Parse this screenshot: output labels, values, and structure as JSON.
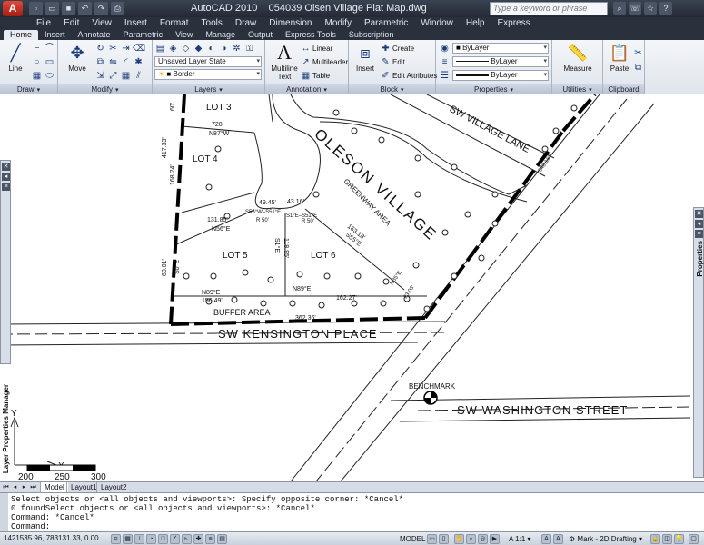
{
  "title_bar": {
    "app_name": "AutoCAD 2010",
    "file_name": "054039 Olsen Village Plat Map.dwg",
    "logo_letter": "A",
    "search_placeholder": "Type a keyword or phrase",
    "qat_icons": [
      "new-icon",
      "open-icon",
      "save-icon",
      "undo-icon",
      "redo-icon",
      "plot-icon"
    ],
    "info_icons": [
      "binoculars-icon",
      "communication-center-icon",
      "favorites-icon",
      "help-icon"
    ]
  },
  "menu": [
    "File",
    "Edit",
    "View",
    "Insert",
    "Format",
    "Tools",
    "Draw",
    "Dimension",
    "Modify",
    "Parametric",
    "Window",
    "Help",
    "Express"
  ],
  "ribbon_tabs": [
    "Home",
    "Insert",
    "Annotate",
    "Parametric",
    "View",
    "Manage",
    "Output",
    "Express Tools",
    "Subscription"
  ],
  "active_ribbon_tab": "Home",
  "ribbon": {
    "draw": {
      "title": "Draw",
      "line_label": "Line"
    },
    "modify": {
      "title": "Modify",
      "move_label": "Move"
    },
    "layers": {
      "title": "Layers",
      "layer_state": "Unsaved Layer State",
      "current_layer": "Border"
    },
    "annotation": {
      "title": "Annotation",
      "multiline_text_label": "Multiline Text",
      "linear_label": "Linear",
      "multileader_label": "Multileader",
      "table_label": "Table"
    },
    "block": {
      "title": "Block",
      "insert_label": "Insert",
      "create_label": "Create",
      "edit_label": "Edit",
      "edit_attributes_label": "Edit Attributes"
    },
    "properties": {
      "title": "Properties",
      "color_value": "ByLayer",
      "linetype_value": "ByLayer",
      "lineweight_value": "ByLayer"
    },
    "utilities": {
      "title": "Utilities",
      "measure_label": "Measure"
    },
    "clipboard": {
      "title": "Clipboard",
      "paste_label": "Paste"
    }
  },
  "drawing": {
    "lots": [
      "LOT 3",
      "LOT 4",
      "LOT 5",
      "LOT 6"
    ],
    "street_labels": [
      "SW KENSINGTON PLACE",
      "SW WASHINGTON STREET",
      "SW VILLAGE LANE",
      "OLESON VILLAGE",
      "GREENWAY AREA",
      "BUFFER AREA",
      "BENCHMARK"
    ],
    "dimensions": [
      "720'",
      "N87°W",
      "417.33'",
      "168.24'",
      "131.85'",
      "N56°E",
      "49.45'",
      "43.16'",
      "S55°W–S51°E",
      "R 50'",
      "S1°E–S51°E",
      "R 50'",
      "118.95'",
      "S1°E",
      "163.18'",
      "S55°E",
      "N89°E",
      "162.27'",
      "N89°E",
      "156.49'",
      "N35°E",
      "23.06'",
      "60.01'",
      "S0°E",
      "362.36'",
      "S48.16'",
      "60'"
    ],
    "scale_bar": [
      "200",
      "250",
      "300"
    ],
    "ucs_y": "Y",
    "ucs_x": "X"
  },
  "palettes": {
    "left_label": "Layer Properties Manager",
    "right_label": "Properties"
  },
  "layout_tabs": [
    "Model",
    "Layout1",
    "Layout2"
  ],
  "active_layout": "Model",
  "command_lines": [
    "Select objects or <all objects and viewports>: Specify opposite corner: *Cancel*",
    "0 foundSelect objects or <all objects and viewports>: *Cancel*",
    "Command: *Cancel*",
    "Command:"
  ],
  "status": {
    "coords": "1421535.96, 783131.33, 0.00",
    "model_label": "MODEL",
    "annotation_scale": "1:1",
    "workspace": "Mark - 2D Drafting"
  }
}
